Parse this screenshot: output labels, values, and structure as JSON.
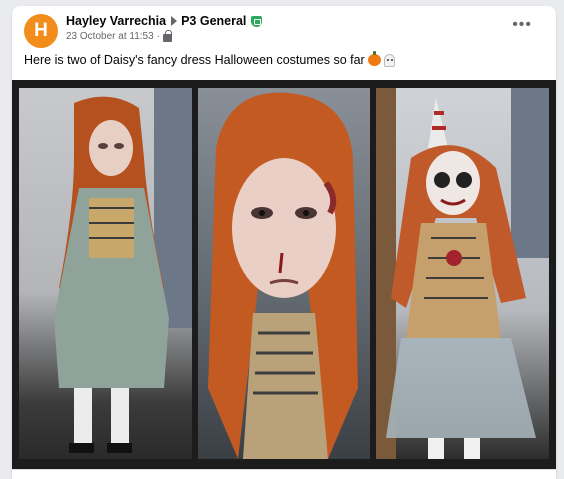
{
  "post": {
    "avatar_letter": "H",
    "author": "Hayley Varrechia",
    "group": "P3 General",
    "timestamp": "23 October at 11:53",
    "separator": "·",
    "text": "Here is two of Daisy's fancy dress Halloween costumes so far",
    "icons": [
      "pumpkin-emoji",
      "ghost-emoji",
      "admin-shield-icon",
      "audience-icon",
      "more-options-icon"
    ]
  },
  "photos": [
    {
      "id": "photo-1"
    },
    {
      "id": "photo-2"
    },
    {
      "id": "photo-3"
    }
  ],
  "colors": {
    "avatar": "#f28c1b",
    "shield": "#2aa85e",
    "secondary_text": "#65676b"
  }
}
